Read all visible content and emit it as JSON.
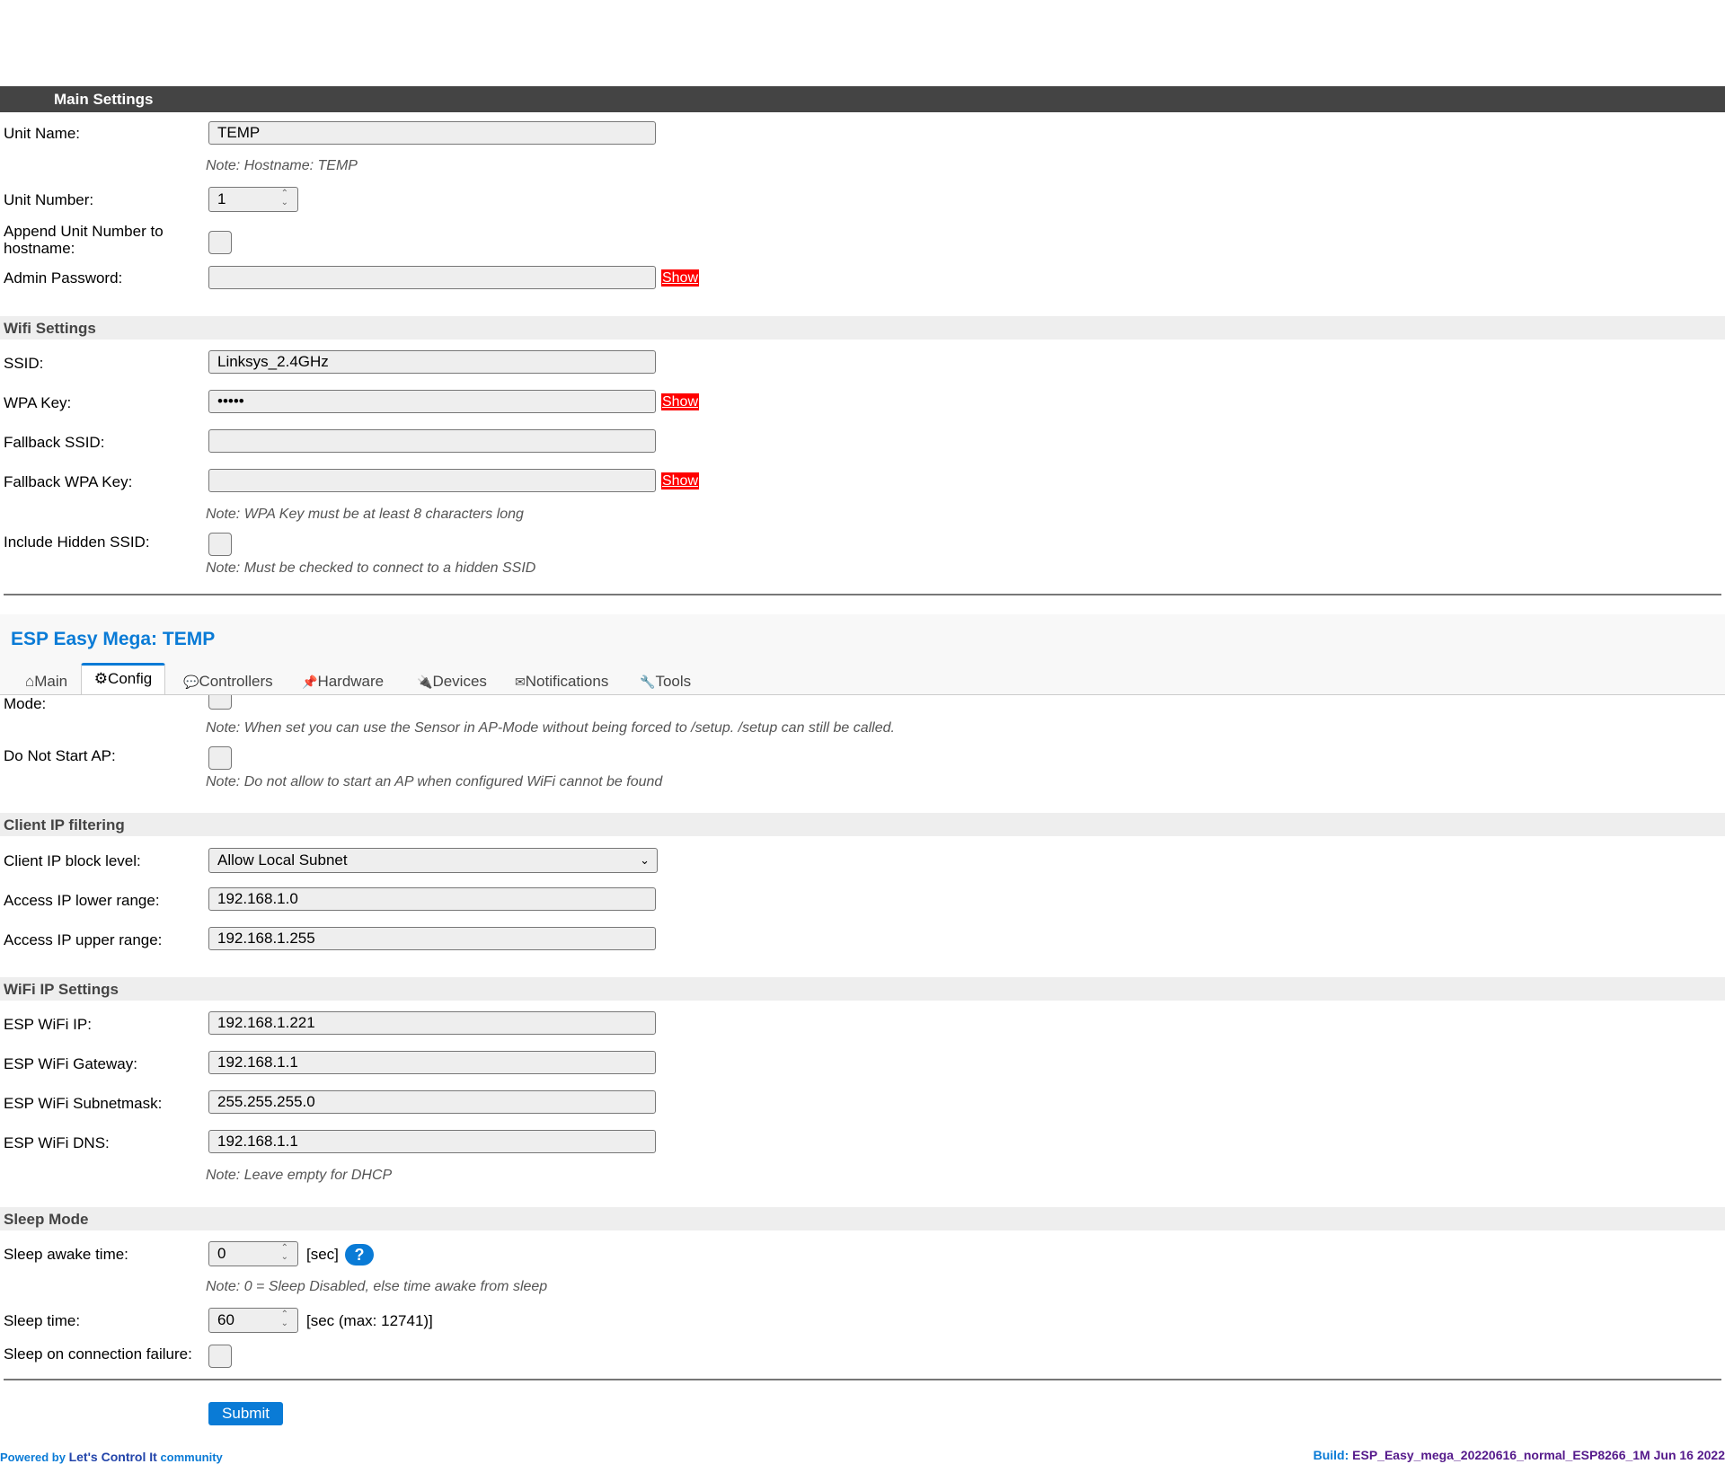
{
  "main_settings": {
    "header": "Main Settings",
    "unit_name_label": "Unit Name:",
    "unit_name_value": "TEMP",
    "hostname_note": "Note: Hostname: TEMP",
    "unit_number_label": "Unit Number:",
    "unit_number_value": "1",
    "append_label": "Append Unit Number to hostname:",
    "admin_password_label": "Admin Password:",
    "admin_password_value": "",
    "show_label": "Show"
  },
  "wifi_settings": {
    "header": "Wifi Settings",
    "ssid_label": "SSID:",
    "ssid_value": "Linksys_2.4GHz",
    "wpa_key_label": "WPA Key:",
    "wpa_key_value": "•••••",
    "fallback_ssid_label": "Fallback SSID:",
    "fallback_ssid_value": "",
    "fallback_wpa_label": "Fallback WPA Key:",
    "fallback_wpa_value": "",
    "wpa_note": "Note: WPA Key must be at least 8 characters long",
    "hidden_ssid_label": "Include Hidden SSID:",
    "hidden_note": "Note: Must be checked to connect to a hidden SSID"
  },
  "app": {
    "title": "ESP Easy Mega: TEMP",
    "tabs": {
      "main": "⌂Main",
      "config": "⚙Config",
      "controllers": "Controllers",
      "hardware": "Hardware",
      "devices": "Devices",
      "notifications": "Notifications",
      "tools": "Tools"
    }
  },
  "ap_settings": {
    "mode_label": "Mode:",
    "mode_note": "Note: When set you can use the Sensor in AP-Mode without being forced to /setup. /setup can still be called.",
    "no_ap_label": "Do Not Start AP:",
    "no_ap_note": "Note: Do not allow to start an AP when configured WiFi cannot be found"
  },
  "client_ip": {
    "header": "Client IP filtering",
    "block_level_label": "Client IP block level:",
    "block_level_value": "Allow Local Subnet",
    "lower_label": "Access IP lower range:",
    "lower_value": "192.168.1.0",
    "upper_label": "Access IP upper range:",
    "upper_value": "192.168.1.255"
  },
  "wifi_ip": {
    "header": "WiFi IP Settings",
    "ip_label": "ESP WiFi IP:",
    "ip_value": "192.168.1.221",
    "gateway_label": "ESP WiFi Gateway:",
    "gateway_value": "192.168.1.1",
    "subnet_label": "ESP WiFi Subnetmask:",
    "subnet_value": "255.255.255.0",
    "dns_label": "ESP WiFi DNS:",
    "dns_value": "192.168.1.1",
    "dhcp_note": "Note: Leave empty for DHCP"
  },
  "sleep": {
    "header": "Sleep Mode",
    "awake_label": "Sleep awake time:",
    "awake_value": "0",
    "awake_unit": "[sec]",
    "help": "?",
    "awake_note": "Note: 0 = Sleep Disabled, else time awake from sleep",
    "sleep_label": "Sleep time:",
    "sleep_value": "60",
    "sleep_unit": "[sec (max: 12741)]",
    "failure_label": "Sleep on connection failure:"
  },
  "submit_label": "Submit",
  "footer": {
    "powered_by": "Powered by",
    "community_link": "Let's Control It",
    "community": "community",
    "build_label": "Build:",
    "build_value": "ESP_Easy_mega_20220616_normal_ESP8266_1M Jun 16 2022"
  },
  "colors": {
    "accent": "#0a7bd6",
    "header_bg": "#444444",
    "show_button": "#ff0000"
  }
}
